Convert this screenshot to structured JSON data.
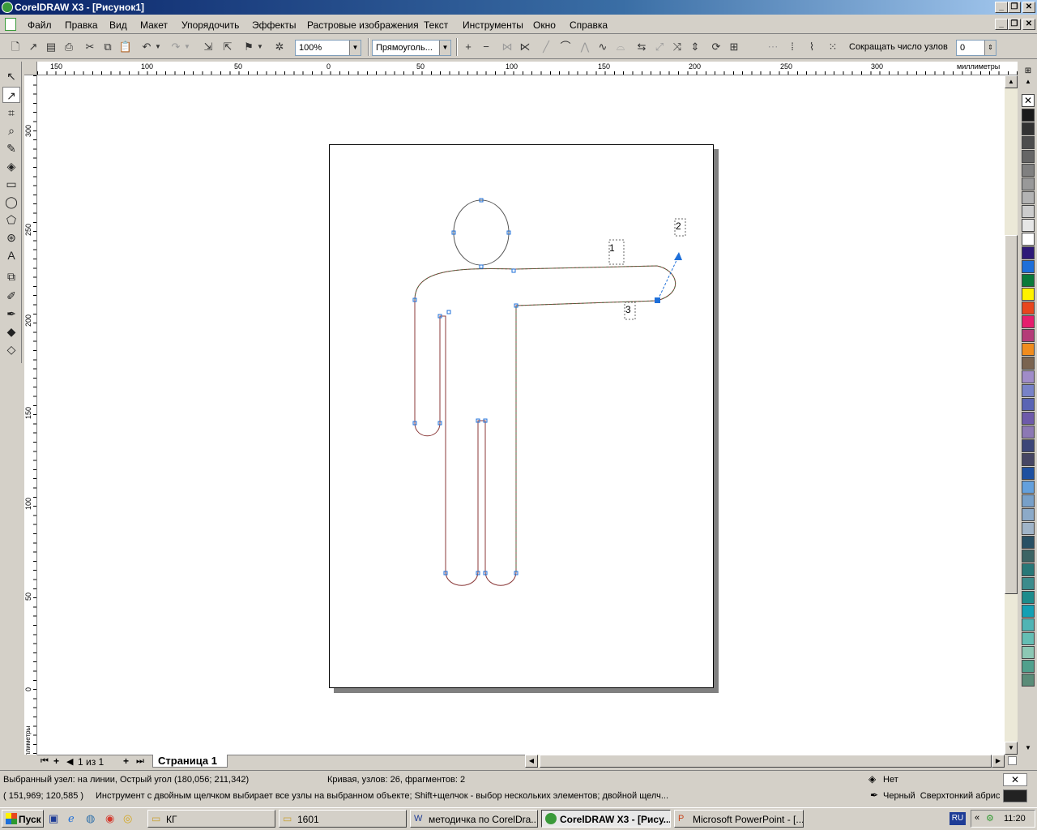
{
  "window": {
    "title": "CorelDRAW X3 - [Рисунок1]"
  },
  "menu": [
    "Файл",
    "Правка",
    "Вид",
    "Макет",
    "Упорядочить",
    "Эффекты",
    "Растровые изображения",
    "Текст",
    "Инструменты",
    "Окно",
    "Справка"
  ],
  "toolbar": {
    "zoom_value": "100%",
    "mode_value": "Прямоуголь...",
    "reduce_nodes_label": "Сокращать число узлов",
    "reduce_nodes_value": "0"
  },
  "rulers": {
    "h_ticks": [
      "150",
      "100",
      "50",
      "0",
      "50",
      "100",
      "150",
      "200",
      "250",
      "300"
    ],
    "h_unit": "миллиметры",
    "v_ticks": [
      "300",
      "250",
      "200",
      "150",
      "100",
      "50",
      "0"
    ],
    "v_unit": "миллиметры"
  },
  "drawing": {
    "label1": "1",
    "label2": "2",
    "label3": "3"
  },
  "page_nav": {
    "counter": "1 из 1",
    "tab": "Страница 1"
  },
  "status": {
    "node_info": "Выбранный узел: на линии, Острый угол (180,056; 211,342)",
    "curve_info": "Кривая, узлов: 26, фрагментов: 2",
    "coords": "( 151,969; 120,585 )",
    "hint": "Инструмент с двойным щелчком выбирает все узлы на выбранном объекте; Shift+щелчок - выбор нескольких элементов; двойной щелч...",
    "fill_label": "Нет",
    "outline_label": "Черный  Сверхтонкий абрис"
  },
  "taskbar": {
    "start": "Пуск",
    "tasks": [
      "КГ",
      "1601",
      "методичка по CorelDra...",
      "CorelDRAW X3 - [Рису...",
      "Microsoft PowerPoint - [..."
    ],
    "lang": "RU",
    "clock": "11:20"
  },
  "palette": [
    "#ffffff",
    "#1a1a1a",
    "#333333",
    "#4d4d4d",
    "#666666",
    "#808080",
    "#999999",
    "#b3b3b3",
    "#cccccc",
    "#e6e6e6",
    "#ffffff",
    "#2e1a78",
    "#1e6fd9",
    "#0a7a3a",
    "#fff200",
    "#e8461e",
    "#e61e6e",
    "#b43c78",
    "#f08c1e",
    "#7a6450",
    "#a08cc8",
    "#7882c8",
    "#5a64b4",
    "#6e5aaa",
    "#8c78b4",
    "#3c4678",
    "#464664",
    "#1e50a0",
    "#64a0dc",
    "#78a0c8",
    "#8caac8",
    "#a0b4c8",
    "#285064",
    "#3c6464",
    "#287878",
    "#3c8c8c",
    "#1e8c8c",
    "#14a0b4",
    "#50b4b4",
    "#64beb4",
    "#8cc8b4",
    "#50a08c",
    "#5a8c78"
  ]
}
